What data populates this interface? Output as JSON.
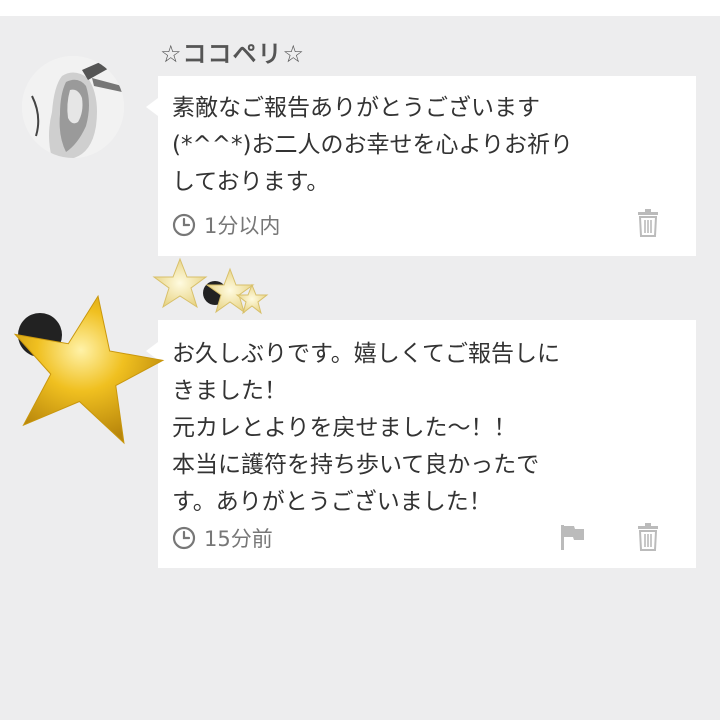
{
  "comments": [
    {
      "username": "☆ココペリ☆",
      "avatar_icon": "user-avatar-photo",
      "text": "素敵なご報告ありがとうございます\n(*^^*)お二人のお幸せを心よりお祈り\nしております。",
      "time": "1分以内",
      "actions": [
        "delete"
      ]
    },
    {
      "avatar_icon": "gold-star-avatar",
      "text": "お久しぶりです。嬉しくてご報告しに\nきました！\n元カレとよりを戻せました〜！！\n本当に護符を持ち歩いて良かったで\nす。ありがとうございました！",
      "time": "15分前",
      "actions": [
        "report",
        "delete"
      ]
    }
  ],
  "colors": {
    "background": "#ededee",
    "bubble": "#ffffff",
    "text": "#333333",
    "meta_text": "#777777",
    "icon": "#bbbbbb",
    "star_gold": "#e9b81b"
  }
}
